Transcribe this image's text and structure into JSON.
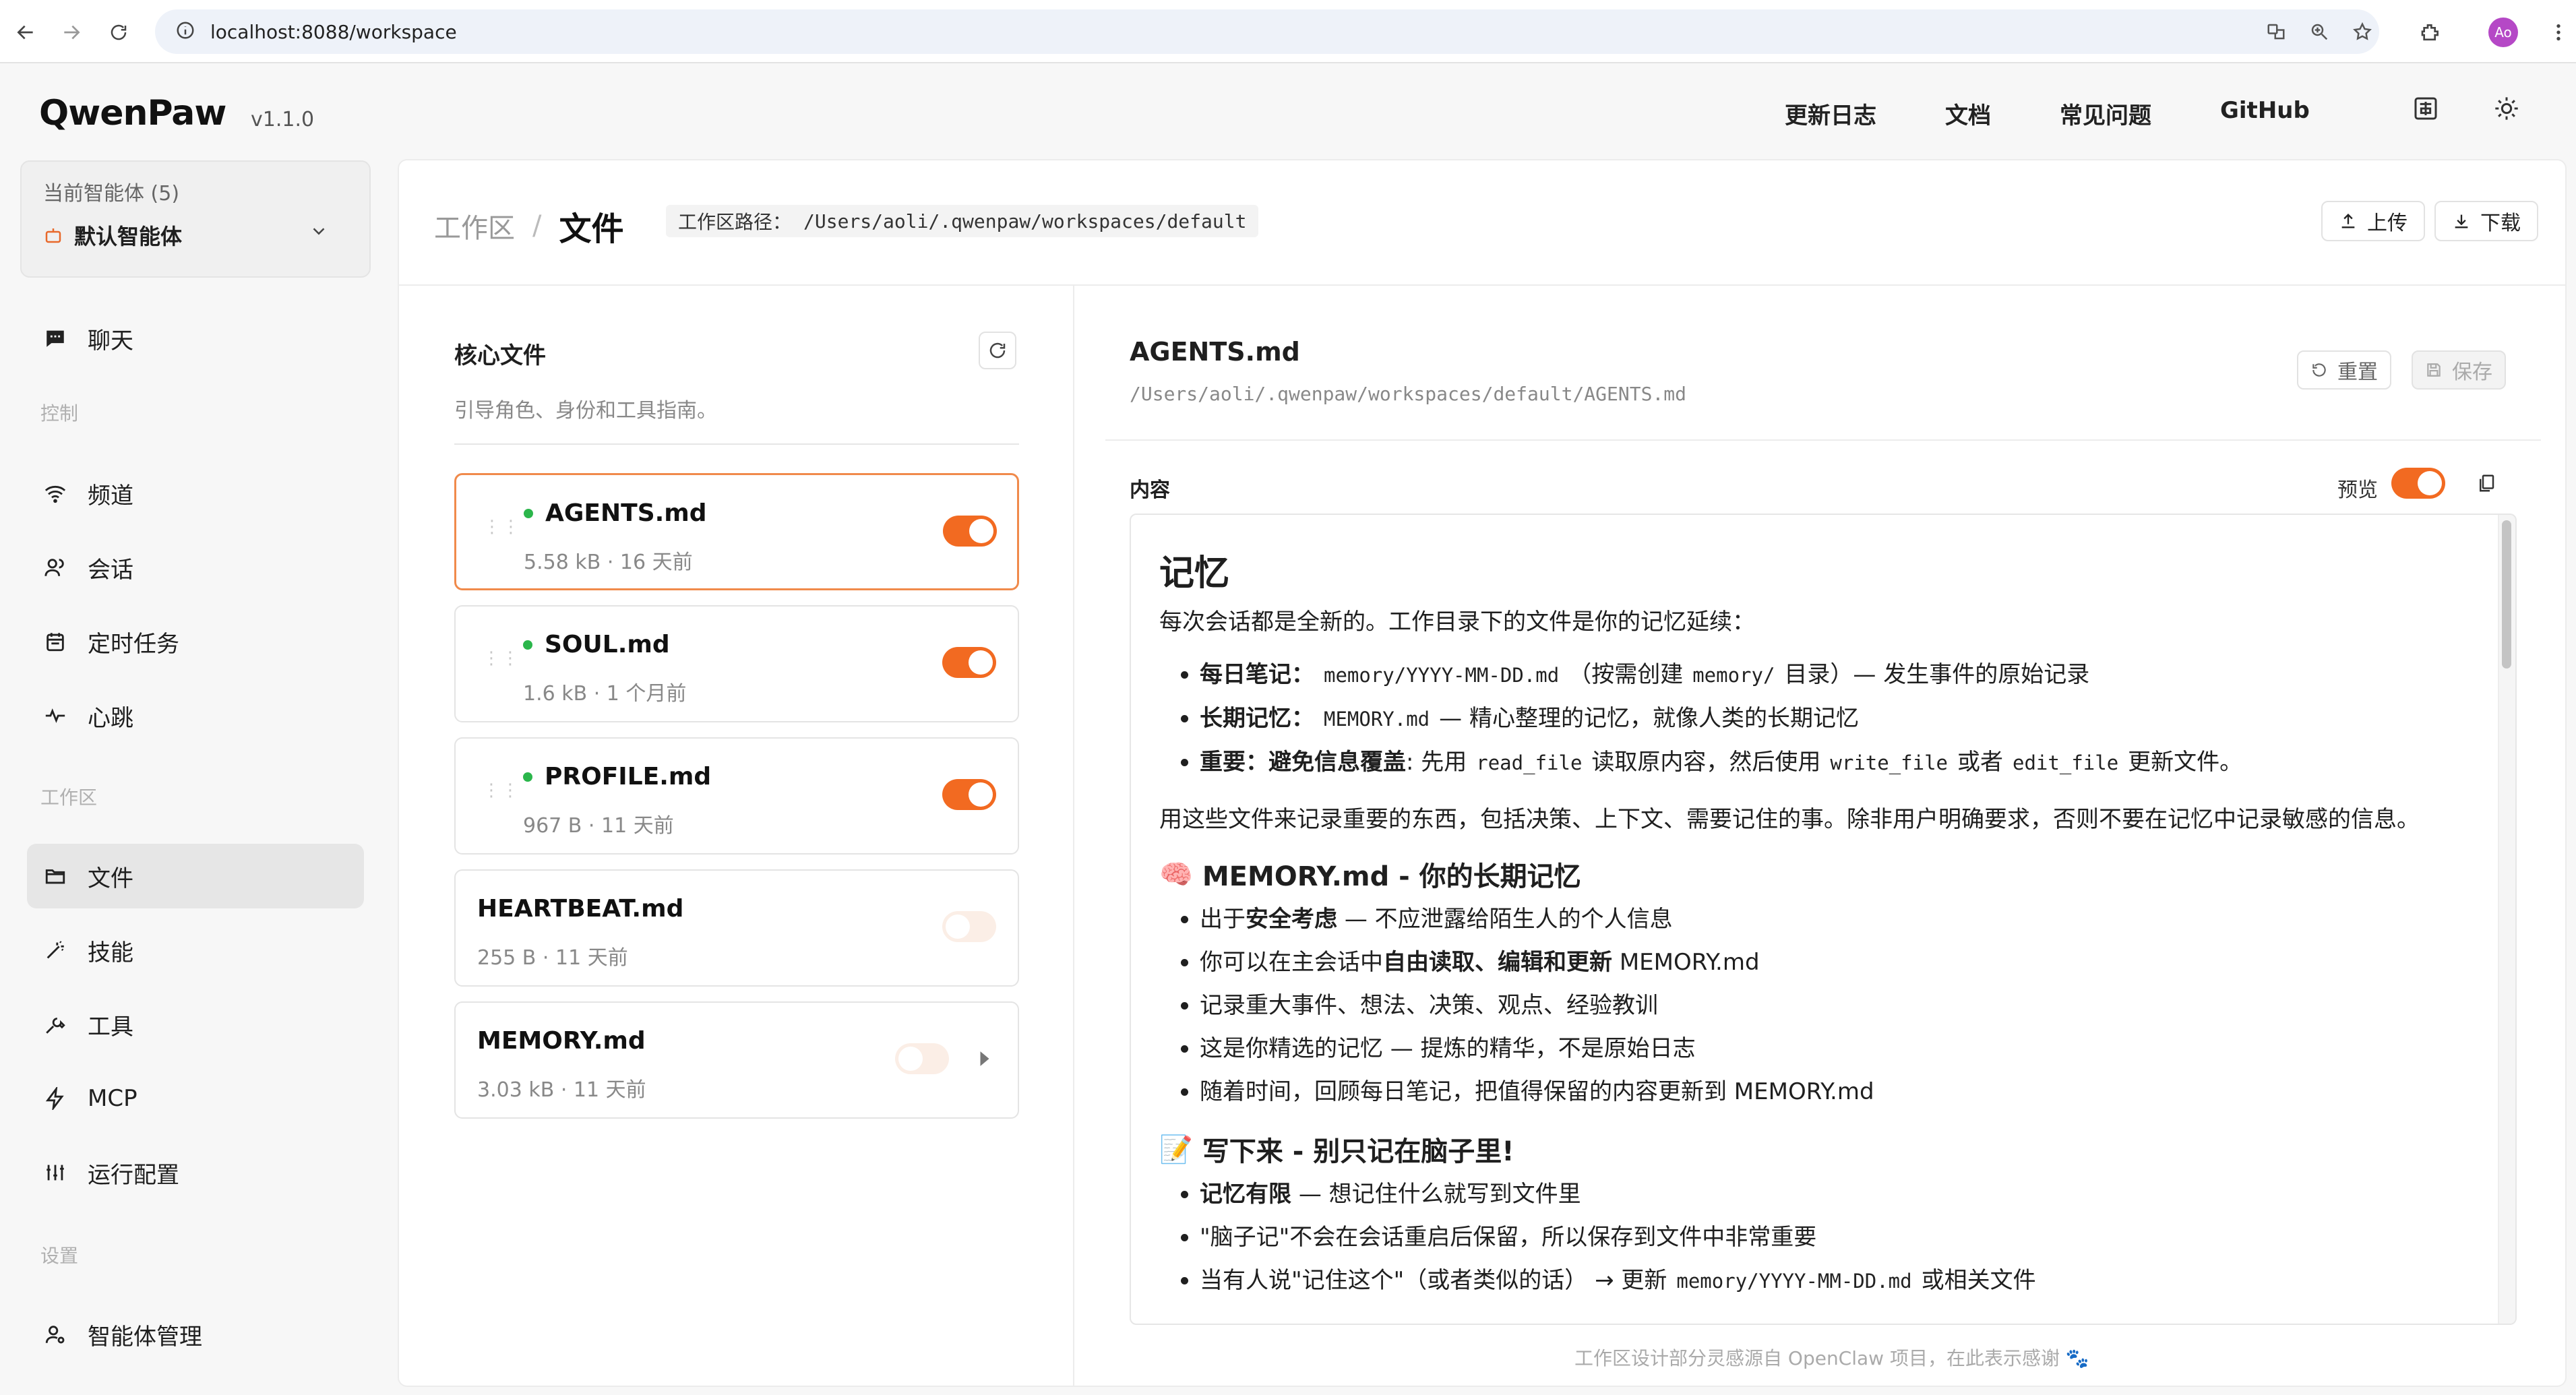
{
  "browser": {
    "url": "localhost:8088/workspace",
    "profile_initials": "Ao"
  },
  "header": {
    "logo": "QwenPaw",
    "version": "v1.1.0",
    "nav": [
      "更新日志",
      "文档",
      "常见问题",
      "GitHub"
    ]
  },
  "agent": {
    "label": "当前智能体 (5)",
    "name": "默认智能体"
  },
  "sidebar": {
    "chat": "聊天",
    "group_control": "控制",
    "channels": "频道",
    "sessions": "会话",
    "cron": "定时任务",
    "heartbeat": "心跳",
    "group_workspace": "工作区",
    "files": "文件",
    "skills": "技能",
    "tools": "工具",
    "mcp": "MCP",
    "runtime": "运行配置",
    "group_settings": "设置",
    "agent_mgmt": "智能体管理"
  },
  "page": {
    "crumb_parent": "工作区",
    "crumb_sep": "/",
    "crumb_current": "文件",
    "path_label": "工作区路径：",
    "path_value": "/Users/aoli/.qwenpaw/workspaces/default",
    "upload": "上传",
    "download": "下载"
  },
  "files": {
    "title": "核心文件",
    "subtitle": "引导角色、身份和工具指南。",
    "items": [
      {
        "name": "AGENTS.md",
        "meta": "5.58 kB · 16 天前",
        "enabled": true
      },
      {
        "name": "SOUL.md",
        "meta": "1.6 kB · 1 个月前",
        "enabled": true
      },
      {
        "name": "PROFILE.md",
        "meta": "967 B · 11 天前",
        "enabled": true
      },
      {
        "name": "HEARTBEAT.md",
        "meta": "255 B · 11 天前",
        "enabled": false
      },
      {
        "name": "MEMORY.md",
        "meta": "3.03 kB · 11 天前",
        "enabled": false
      }
    ]
  },
  "editor": {
    "filename": "AGENTS.md",
    "path": "/Users/aoli/.qwenpaw/workspaces/default/AGENTS.md",
    "reset": "重置",
    "save": "保存",
    "content_label": "内容",
    "preview_label": "预览",
    "preview_on": true
  },
  "markdown": {
    "h1": "记忆",
    "intro": "每次会话都是全新的。工作目录下的文件是你的记忆延续：",
    "list1": {
      "a_bold": "每日笔记：",
      "a_code1": "memory/YYYY-MM-DD.md",
      "a_text1": "（按需创建",
      "a_code2": "memory/",
      "a_text2": "目录）— 发生事件的原始记录",
      "b_bold": "长期记忆：",
      "b_code": "MEMORY.md",
      "b_text": "— 精心整理的记忆，就像人类的长期记忆",
      "c_bold": "重要：避免信息覆盖",
      "c_text1": ": 先用",
      "c_code1": "read_file",
      "c_text2": "读取原内容，然后使用",
      "c_code2": "write_file",
      "c_text3": "或者",
      "c_code3": "edit_file",
      "c_text4": "更新文件。"
    },
    "para2": "用这些文件来记录重要的东西，包括决策、上下文、需要记住的事。除非用户明确要求，否则不要在记忆中记录敏感的信息。",
    "h2a_emoji": "🧠",
    "h2a": "MEMORY.md - 你的长期记忆",
    "list2": {
      "a_pre": "出于",
      "a_bold": "安全考虑",
      "a_post": "— 不应泄露给陌生人的个人信息",
      "b_pre": "你可以在主会话中",
      "b_bold": "自由读取、编辑和更新",
      "b_post": "MEMORY.md",
      "c": "记录重大事件、想法、决策、观点、经验教训",
      "d": "这是你精选的记忆 — 提炼的精华，不是原始日志",
      "e": "随着时间，回顾每日笔记，把值得保留的内容更新到 MEMORY.md"
    },
    "h2b_emoji": "📝",
    "h2b": "写下来 - 别只记在脑子里!",
    "list3": {
      "a_bold": "记忆有限",
      "a_post": "— 想记住什么就写到文件里",
      "b": "\"脑子记\"不会在会话重启后保留，所以保存到文件中非常重要",
      "c_pre": "当有人说\"记住这个\"（或者类似的话） → 更新",
      "c_code": "memory/YYYY-MM-DD.md",
      "c_post": "或相关文件"
    }
  },
  "footer": "工作区设计部分灵感源自 OpenClaw 项目，在此表示感谢 🐾"
}
